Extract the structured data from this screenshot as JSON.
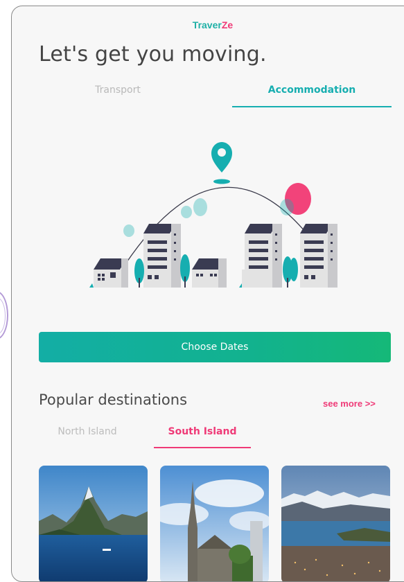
{
  "app": {
    "brand_main": "Traver",
    "brand_accent": "Ze"
  },
  "headline": "Let's get you moving.",
  "tabs": [
    {
      "label": "Transport",
      "active": false
    },
    {
      "label": "Accommodation",
      "active": true
    }
  ],
  "cta": {
    "label": "Choose Dates"
  },
  "popular": {
    "title": "Popular destinations",
    "see_more": "see more >>",
    "tabs": [
      {
        "label": "North Island",
        "active": false
      },
      {
        "label": "South Island",
        "active": true
      }
    ],
    "cards": [
      {
        "image": "fiord-mountain-lake"
      },
      {
        "image": "cathedral-spire"
      },
      {
        "image": "lake-town-snowy-mountains"
      }
    ]
  },
  "colors": {
    "teal": "#16aeb0",
    "pink": "#ef3a77",
    "gradient_start": "#13aea5",
    "gradient_end": "#15b878"
  }
}
